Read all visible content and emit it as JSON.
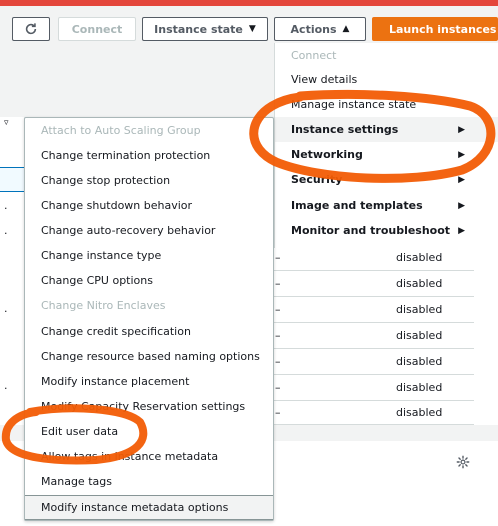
{
  "toolbar": {
    "refresh_icon": "refresh-icon",
    "connect_label": "Connect",
    "instance_state_label": "Instance state",
    "actions_label": "Actions",
    "launch_label": "Launch instances"
  },
  "actions_menu": {
    "items": [
      {
        "label": "Connect",
        "state": "disabled"
      },
      {
        "label": "View details",
        "state": "normal"
      },
      {
        "label": "Manage instance state",
        "state": "normal"
      },
      {
        "label": "Instance settings",
        "state": "active",
        "submenu": true
      },
      {
        "label": "Networking",
        "state": "bold",
        "submenu": true
      },
      {
        "label": "Security",
        "state": "bold",
        "submenu": true
      },
      {
        "label": "Image and templates",
        "state": "bold",
        "submenu": true
      },
      {
        "label": "Monitor and troubleshoot",
        "state": "bold",
        "submenu": true
      }
    ]
  },
  "instance_settings_submenu": {
    "items": [
      {
        "label": "Attach to Auto Scaling Group",
        "state": "disabled"
      },
      {
        "label": "Change termination protection",
        "state": "normal"
      },
      {
        "label": "Change stop protection",
        "state": "normal"
      },
      {
        "label": "Change shutdown behavior",
        "state": "normal"
      },
      {
        "label": "Change auto-recovery behavior",
        "state": "normal"
      },
      {
        "label": "Change instance type",
        "state": "normal"
      },
      {
        "label": "Change CPU options",
        "state": "normal"
      },
      {
        "label": "Change Nitro Enclaves",
        "state": "disabled"
      },
      {
        "label": "Change credit specification",
        "state": "normal"
      },
      {
        "label": "Change resource based naming options",
        "state": "normal"
      },
      {
        "label": "Modify instance placement",
        "state": "normal"
      },
      {
        "label": "Modify Capacity Reservation settings",
        "state": "normal"
      },
      {
        "label": "Edit user data",
        "state": "normal"
      },
      {
        "label": "Allow tags in instance metadata",
        "state": "normal"
      },
      {
        "label": "Manage tags",
        "state": "normal"
      },
      {
        "label": "Modify instance metadata options",
        "state": "hover"
      }
    ]
  },
  "table": {
    "rows": [
      {
        "dash": "–",
        "value": "disabled"
      },
      {
        "dash": "–",
        "value": "disabled"
      },
      {
        "dash": "–",
        "value": "disabled"
      },
      {
        "dash": "–",
        "value": "disabled"
      },
      {
        "dash": "–",
        "value": "disabled"
      },
      {
        "dash": "–",
        "value": "disabled"
      },
      {
        "dash": "–",
        "value": "disabled"
      }
    ]
  },
  "icons": {
    "settings": "gear-icon",
    "filter_caret": "chevron-down-icon",
    "submenu_arrow": "caret-right-icon"
  },
  "colors": {
    "accent_orange": "#ec7211",
    "annotation_orange": "#f25c05",
    "top_stripe": "#e4463b",
    "disabled_text": "#aab7b8"
  }
}
